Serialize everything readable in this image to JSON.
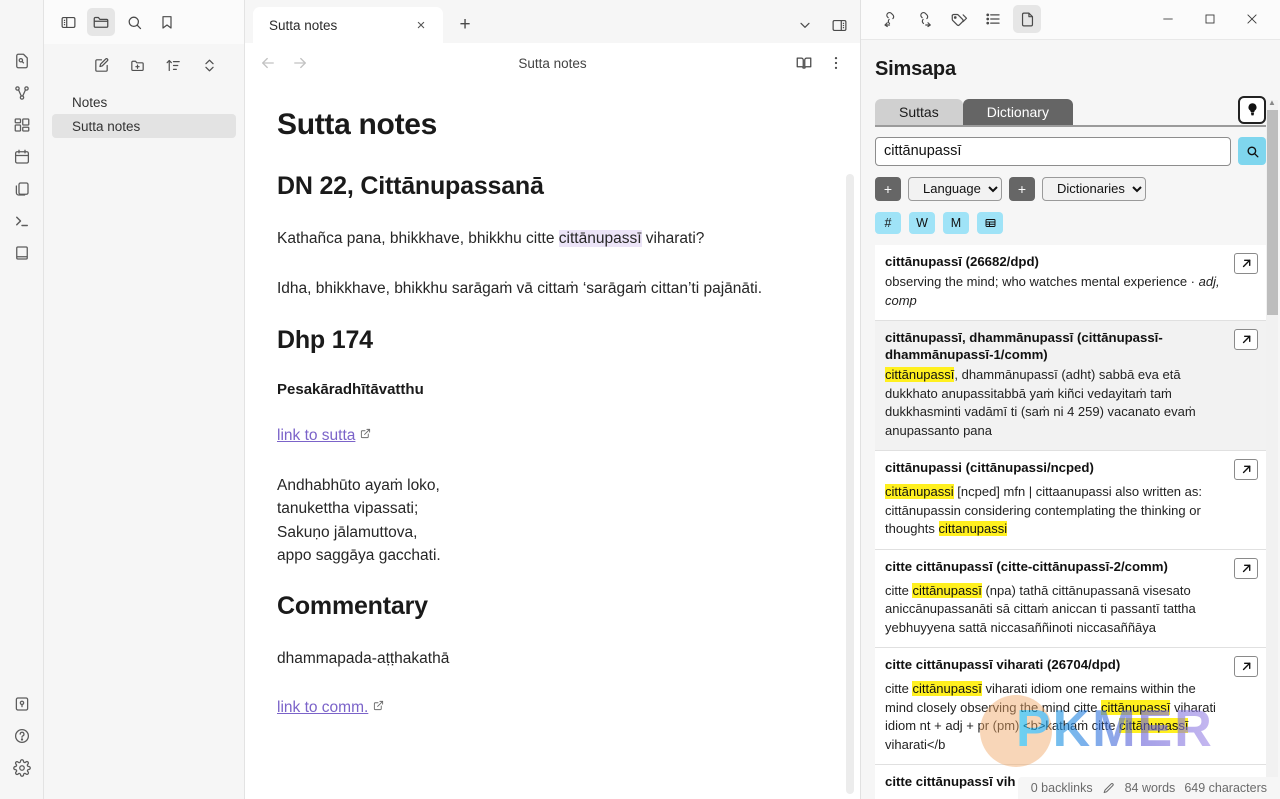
{
  "sidebar_rail": {
    "items": [
      {
        "icon": "file-search-icon",
        "name": "quick-switcher"
      },
      {
        "icon": "graph-icon",
        "name": "graph-view"
      },
      {
        "icon": "canvas-icon",
        "name": "canvas"
      },
      {
        "icon": "calendar-icon",
        "name": "calendar"
      },
      {
        "icon": "copy-files-icon",
        "name": "daily-notes"
      },
      {
        "icon": "terminal-icon",
        "name": "terminal"
      },
      {
        "icon": "book-icon",
        "name": "reading-view"
      }
    ],
    "bottom_items": [
      {
        "icon": "vault-icon",
        "name": "open-vault"
      },
      {
        "icon": "help-icon",
        "name": "help"
      },
      {
        "icon": "gear-icon",
        "name": "settings"
      }
    ]
  },
  "sidebar": {
    "topbar": [
      {
        "icon": "sidebar-toggle-icon",
        "name": "toggle-left-sidebar",
        "active": false
      },
      {
        "icon": "folder-icon",
        "name": "file-explorer",
        "active": true
      },
      {
        "icon": "search-icon",
        "name": "search",
        "active": false
      },
      {
        "icon": "bookmark-icon",
        "name": "bookmarks",
        "active": false
      }
    ],
    "tools": [
      {
        "icon": "new-note-icon",
        "name": "new-note"
      },
      {
        "icon": "new-folder-icon",
        "name": "new-folder"
      },
      {
        "icon": "sort-icon",
        "name": "change-sort-order"
      },
      {
        "icon": "collapse-icon",
        "name": "expand-collapse-all"
      }
    ],
    "tree": [
      {
        "label": "Notes",
        "selected": false
      },
      {
        "label": "Sutta notes",
        "selected": true
      }
    ]
  },
  "editor": {
    "tab": {
      "label": "Sutta notes",
      "close": "×"
    },
    "add_tab": "+",
    "tabbar_right": [
      {
        "icon": "chevron-down-icon",
        "name": "tab-list"
      },
      {
        "icon": "right-sidebar-toggle-icon",
        "name": "toggle-right-sidebar"
      }
    ],
    "view_title": "Sutta notes",
    "nav": [
      {
        "icon": "arrow-left-icon",
        "name": "navigate-back"
      },
      {
        "icon": "arrow-right-icon",
        "name": "navigate-forward"
      }
    ],
    "actions": [
      {
        "icon": "book-open-icon",
        "name": "toggle-reading-view"
      },
      {
        "icon": "more-options-icon",
        "name": "more-options"
      }
    ],
    "doc": {
      "h1": "Sutta notes",
      "h2_dn": "DN 22, Cittānupassanā",
      "p1_before": "Kathañca pana, bhikkhave, bhikkhu citte ",
      "p1_highlight": "cittānupassī",
      "p1_after": " viharati?",
      "p2": "Idha, bhikkhave, bhikkhu sarāgaṁ vā cittaṁ ‘sarāgaṁ cittan’ti pajānāti.",
      "h2_dhp": "Dhp 174",
      "h3_story": "Pesakāradhītāvatthu",
      "link_sutta": "link to sutta",
      "verse_1": "Andhabhūto ayaṁ loko,",
      "verse_2": "tanukettha vipassati;",
      "verse_3": "Sakuṇo jālamuttova,",
      "verse_4": "appo saggāya gacchati.",
      "h2_comm": "Commentary",
      "p_comm": "dhammapada-aṭṭhakathā",
      "link_comm": "link to comm."
    }
  },
  "right_panel": {
    "topbar_icons": [
      {
        "icon": "backlinks-icon",
        "name": "backlinks",
        "active": false
      },
      {
        "icon": "outgoing-links-icon",
        "name": "outgoing-links",
        "active": false
      },
      {
        "icon": "tags-icon",
        "name": "tags",
        "active": false
      },
      {
        "icon": "outline-icon",
        "name": "outline",
        "active": false
      },
      {
        "icon": "file-icon",
        "name": "simsapa-panel",
        "active": true
      }
    ],
    "window_controls": [
      {
        "icon": "minimize-icon",
        "name": "minimize-window",
        "glyph": "—"
      },
      {
        "icon": "maximize-icon",
        "name": "maximize-window",
        "glyph": "□"
      },
      {
        "icon": "close-icon",
        "name": "close-window",
        "glyph": "✕"
      }
    ],
    "title": "Simsapa",
    "tabs": [
      {
        "label": "Suttas",
        "active": false
      },
      {
        "label": "Dictionary",
        "active": true
      }
    ],
    "bulb_icon": "lightbulb-icon",
    "search": {
      "value": "cittānupassī",
      "placeholder": "",
      "button_icon": "search-icon"
    },
    "controls": [
      {
        "type": "plus",
        "label": "+"
      },
      {
        "type": "select",
        "label": "Language",
        "selected": "Language"
      },
      {
        "type": "plus",
        "label": "+"
      },
      {
        "type": "select",
        "label": "Dictionaries",
        "selected": "Dictionaries"
      }
    ],
    "badges": [
      {
        "label": "#",
        "name": "hash-badge"
      },
      {
        "label": "W",
        "name": "w-badge"
      },
      {
        "label": "M",
        "name": "m-badge"
      },
      {
        "label": "▤",
        "name": "table-badge"
      }
    ],
    "results": [
      {
        "title": "cittānupassī (26682/dpd)",
        "highlighted": false,
        "body_parts": [
          {
            "t": "observing the mind; who watches mental experience · ",
            "m": false,
            "i": false
          },
          {
            "t": "adj, comp",
            "m": false,
            "i": true
          }
        ]
      },
      {
        "title": "cittānupassī, dhammānupassī (cittānupassī-dhammānupassī-1/comm)",
        "highlighted": true,
        "body_parts": [
          {
            "t": "cittānupassī",
            "m": true,
            "i": false
          },
          {
            "t": ", dhammānupassī (adht) sabbā eva etā dukkhato anupassitabbā yaṁ kiñci vedayitaṁ taṁ dukkhasminti vadāmī ti (saṁ ni 4 259) vacanato evaṁ anupassanto pana",
            "m": false,
            "i": false
          }
        ]
      },
      {
        "title": "cittānupassi (cittānupassi/ncped)",
        "highlighted": false,
        "body_parts": [
          {
            "t": "cittānupassi",
            "m": true,
            "i": false
          },
          {
            "t": " [ncped] mfn | cittaanupassi also written as: cittānupassin considering contemplating the thinking or thoughts ",
            "m": false,
            "i": false
          },
          {
            "t": "cittanupassi",
            "m": true,
            "i": false
          }
        ]
      },
      {
        "title": "citte cittānupassī (citte-cittānupassī-2/comm)",
        "highlighted": false,
        "body_parts": [
          {
            "t": "citte ",
            "m": false,
            "i": false
          },
          {
            "t": "cittānupassī",
            "m": true,
            "i": false
          },
          {
            "t": " (npa) tathā cittānupassanā visesato aniccānupassanāti sā cittaṁ aniccan ti passantī tattha yebhuyyena sattā niccasaññinoti niccasaññāya",
            "m": false,
            "i": false
          }
        ]
      },
      {
        "title": "citte cittānupassī viharati (26704/dpd)",
        "highlighted": false,
        "body_parts": [
          {
            "t": "citte ",
            "m": false,
            "i": false
          },
          {
            "t": "cittānupassī",
            "m": true,
            "i": false
          },
          {
            "t": " viharati idiom one remains within the mind closely observing the mind citte ",
            "m": false,
            "i": false
          },
          {
            "t": "cittānupassī",
            "m": true,
            "i": false
          },
          {
            "t": " viharati idiom nt + adj + pr (pm) <b>kathaṁ citte ",
            "m": false,
            "i": false
          },
          {
            "t": "cittānupassī",
            "m": true,
            "i": false
          },
          {
            "t": " viharati</b",
            "m": false,
            "i": false
          }
        ]
      },
      {
        "title": "citte cittānupassī vih",
        "highlighted": false,
        "body_parts": []
      }
    ]
  },
  "status_bar": {
    "backlinks": "0 backlinks",
    "edit_icon": "pencil-icon",
    "words": "84 words",
    "characters": "649 characters"
  },
  "watermark": {
    "text": "PKMER"
  },
  "colors": {
    "accent_badge": "#9fe3f7",
    "search_button": "#7fd6ee",
    "highlight_mark": "#fff01f",
    "selection": "#ece4f8",
    "link": "#7b63c9",
    "active_tab": "#656565"
  }
}
